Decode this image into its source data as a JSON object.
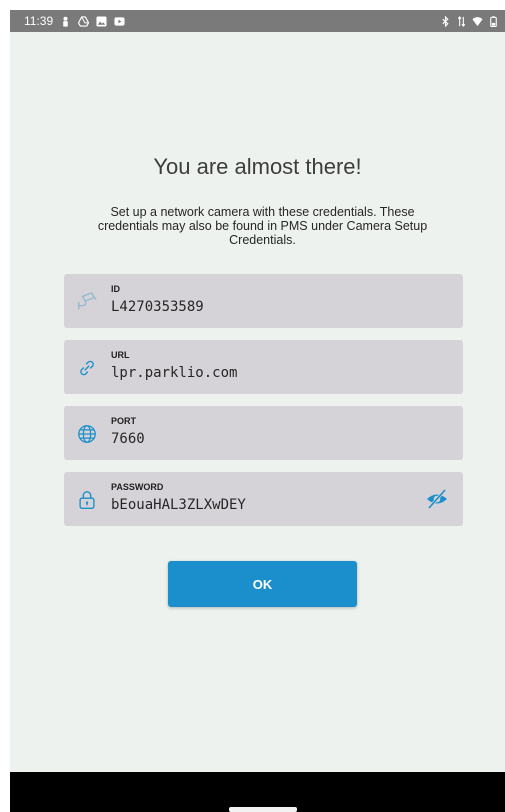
{
  "status_bar": {
    "time": "11:39",
    "left_icons": [
      "person-icon",
      "drive-icon",
      "image-icon",
      "youtube-icon"
    ],
    "right_icons": [
      "bluetooth-icon",
      "data-arrows-icon",
      "wifi-icon",
      "battery-icon"
    ]
  },
  "screen": {
    "title": "You are almost there!",
    "subtitle": "Set up a network camera with these credentials. These credentials may also be found in PMS under Camera Setup Credentials."
  },
  "fields": {
    "id": {
      "label": "ID",
      "value": "L4270353589",
      "icon": "cctv-camera-icon"
    },
    "url": {
      "label": "URL",
      "value": "lpr.parklio.com",
      "icon": "link-icon"
    },
    "port": {
      "label": "PORT",
      "value": "7660",
      "icon": "globe-icon"
    },
    "password": {
      "label": "PASSWORD",
      "value": "bEouaHAL3ZLXwDEY",
      "icon": "lock-icon",
      "toggle_icon": "eye-off-icon"
    }
  },
  "actions": {
    "ok_label": "OK"
  },
  "colors": {
    "accent": "#1b8fcb",
    "background": "#eef2ef",
    "field_bg": "#d6d3d8",
    "status_bar": "#7a7a7a"
  }
}
